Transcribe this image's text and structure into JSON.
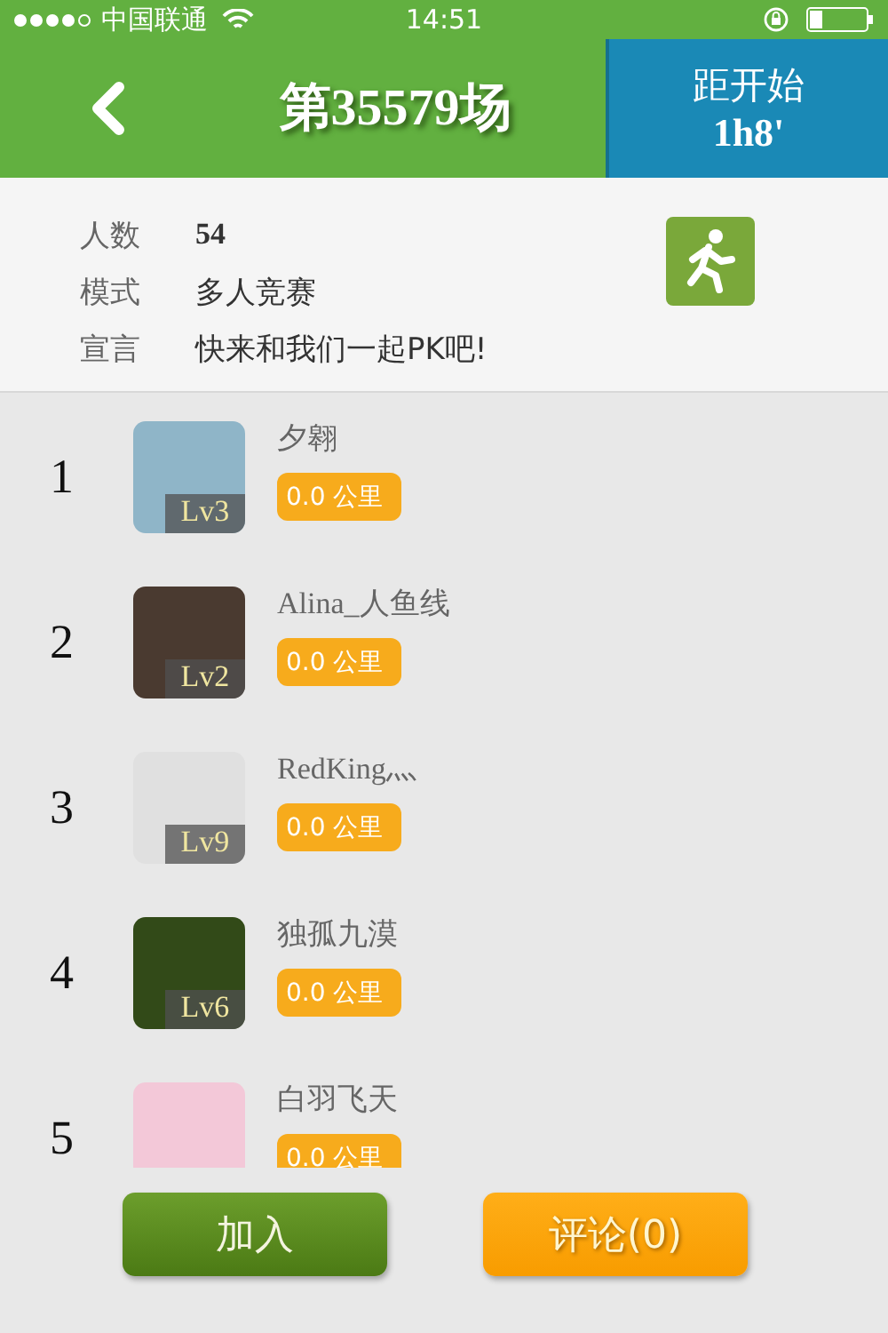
{
  "status_bar": {
    "signal_dots": [
      {
        "on": true
      },
      {
        "on": true
      },
      {
        "on": true
      },
      {
        "on": true
      },
      {
        "on": false
      }
    ],
    "carrier": "中国联通",
    "time": "14:51"
  },
  "header": {
    "title": "第35579场",
    "countdown_label": "距开始",
    "countdown_value": "1h8'"
  },
  "info": [
    {
      "label": "人数",
      "value": "54",
      "bold": true
    },
    {
      "label": "模式",
      "value": "多人竞赛",
      "bold": false
    },
    {
      "label": "宣言",
      "value": "快来和我们一起PK吧!",
      "bold": false
    }
  ],
  "players": [
    {
      "rank": "1",
      "name": "夕翱",
      "level": "Lv3",
      "distance": "0.0 公里"
    },
    {
      "rank": "2",
      "name": "Alina_人鱼线",
      "level": "Lv2",
      "distance": "0.0 公里"
    },
    {
      "rank": "3",
      "name": "RedKing灬",
      "level": "Lv9",
      "distance": "0.0 公里"
    },
    {
      "rank": "4",
      "name": "独孤九漠",
      "level": "Lv6",
      "distance": "0.0 公里"
    },
    {
      "rank": "5",
      "name": "白羽飞天",
      "distance": "0.0 公里"
    }
  ],
  "buttons": [
    {
      "label": "加入",
      "kind": "primary"
    },
    {
      "label": "评论(0)",
      "kind": "secondary"
    }
  ]
}
